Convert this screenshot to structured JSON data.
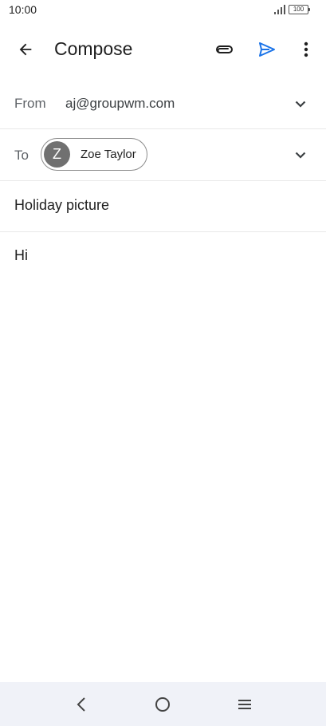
{
  "status_bar": {
    "time": "10:00",
    "battery": "100",
    "icons": [
      "signal-icon",
      "battery-icon"
    ]
  },
  "app_bar": {
    "title": "Compose",
    "icons": [
      "back-arrow-icon",
      "attachment-icon",
      "send-icon",
      "more-vert-icon"
    ],
    "accent_color": "#1a73e8"
  },
  "compose": {
    "from_label": "From",
    "from_value": "aj@groupwm.com",
    "to_label": "To",
    "recipient": {
      "initial": "Z",
      "name": "Zoe Taylor",
      "avatar_color": "#707070"
    },
    "subject": "Holiday picture",
    "body": "Hi"
  },
  "nav_bar": {
    "icons": [
      "nav-back-icon",
      "nav-home-icon",
      "nav-menu-icon"
    ]
  }
}
